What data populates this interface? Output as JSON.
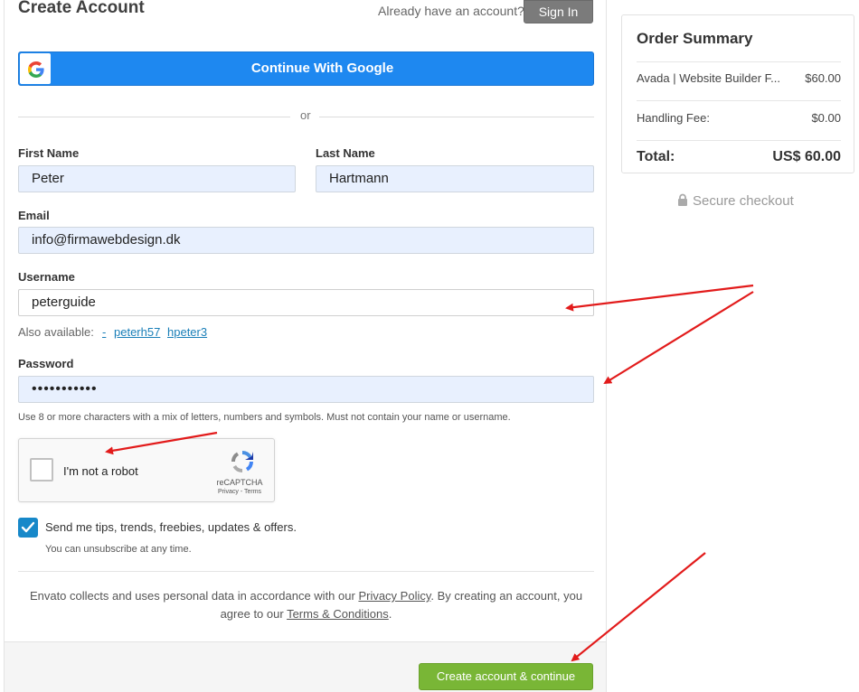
{
  "header": {
    "title": "Create Account",
    "have_account": "Already have an account?",
    "signin_label": "Sign In"
  },
  "google": {
    "label": "Continue With Google",
    "icon": "google-logo-icon"
  },
  "divider_text": "or",
  "form": {
    "first_name": {
      "label": "First Name",
      "value": "Peter"
    },
    "last_name": {
      "label": "Last Name",
      "value": "Hartmann"
    },
    "email": {
      "label": "Email",
      "value": "info@firmawebdesign.dk"
    },
    "username": {
      "label": "Username",
      "value": "peterguide",
      "also_available_label": "Also available:",
      "suggestions": [
        "-",
        "peterh57",
        "hpeter3"
      ]
    },
    "password": {
      "label": "Password",
      "value": "•••••••••••",
      "hint": "Use 8 or more characters with a mix of letters, numbers and symbols. Must not contain your name or username."
    },
    "captcha": {
      "label": "I'm not a robot",
      "brand": "reCAPTCHA",
      "links": "Privacy - Terms",
      "checked": false
    },
    "tips": {
      "label": "Send me tips, trends, freebies, updates & offers.",
      "checked": true,
      "note": "You can unsubscribe at any time."
    }
  },
  "privacy": {
    "text1": "Envato collects and uses personal data in accordance with our ",
    "privacy_link": "Privacy Policy",
    "text2": ". By creating an account, you agree to our ",
    "terms_link": "Terms & Conditions",
    "text3": "."
  },
  "create_button": "Create account & continue",
  "order_summary": {
    "title": "Order Summary",
    "items": [
      {
        "label": "Avada | Website Builder F...",
        "value": "$60.00"
      },
      {
        "label": "Handling Fee:",
        "value": "$0.00"
      }
    ],
    "total_label": "Total:",
    "total_value": "US$ 60.00"
  },
  "secure_checkout": "Secure checkout",
  "colors": {
    "google_blue": "#1e88f0",
    "create_green": "#79b636",
    "checkbox_blue": "#1788c9",
    "annotation_red": "#e21b1b",
    "autofill_bg": "#e8f0fe"
  }
}
